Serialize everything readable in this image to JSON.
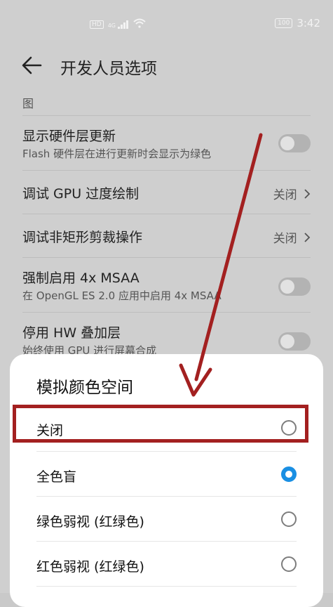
{
  "status_bar": {
    "network_left": "HD",
    "signal_label": "4G",
    "battery": "100",
    "time": "3:42"
  },
  "header": {
    "title": "开发人员选项"
  },
  "section_label": "图",
  "settings": [
    {
      "title": "显示硬件层更新",
      "subtitle": "Flash 硬件层在进行更新时会显示为绿色",
      "control": "toggle"
    },
    {
      "title": "调试 GPU 过度绘制",
      "value": "关闭",
      "control": "value"
    },
    {
      "title": "调试非矩形剪裁操作",
      "value": "关闭",
      "control": "value"
    },
    {
      "title": "强制启用 4x MSAA",
      "subtitle": "在 OpenGL ES 2.0 应用中启用 4x MSAA",
      "control": "toggle"
    },
    {
      "title": "停用 HW 叠加层",
      "subtitle": "始终使用 GPU 进行屏幕合成",
      "control": "toggle"
    }
  ],
  "dialog": {
    "title": "模拟颜色空间",
    "options": [
      {
        "label": "关闭",
        "selected": false
      },
      {
        "label": "全色盲",
        "selected": true
      },
      {
        "label": "绿色弱视 (红绿色)",
        "selected": false
      },
      {
        "label": "红色弱视 (红绿色)",
        "selected": false
      }
    ]
  },
  "colors": {
    "accent": "#1a8fe3",
    "annotation": "#a32020"
  },
  "icons": {
    "back": "arrow-left-icon",
    "chevron": "chevron-right-icon",
    "wifi": "wifi-icon",
    "signal": "signal-icon"
  }
}
